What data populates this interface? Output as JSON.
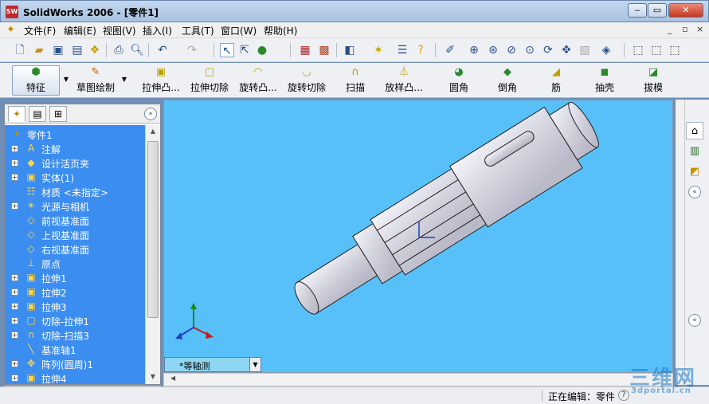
{
  "window": {
    "title": "SolidWorks 2006 - [零件1]",
    "app_icon": "SW"
  },
  "menu": [
    "文件(F)",
    "编辑(E)",
    "视图(V)",
    "插入(I)",
    "工具(T)",
    "窗口(W)",
    "帮助(H)"
  ],
  "mdi_controls": [
    "_",
    "▫",
    "×"
  ],
  "toolbar_icons": [
    "new-icon",
    "open-icon",
    "save-icon",
    "print-icon",
    "undo-icon",
    "redo-icon",
    "select-icon",
    "zoom-icon",
    "rotate-icon",
    "pan-icon",
    "view-orientation-icon"
  ],
  "features_toolbar": {
    "features_tab": "特征",
    "sketch_tab": "草图绘制",
    "buttons": [
      "拉伸凸...",
      "拉伸切除",
      "旋转凸...",
      "旋转切除",
      "扫描",
      "放样凸...",
      "圆角",
      "倒角",
      "筋",
      "抽壳",
      "拔模"
    ]
  },
  "feature_tree": {
    "root": "零件1",
    "items": [
      {
        "label": "注解",
        "icon": "annotation-icon",
        "expandable": true
      },
      {
        "label": "设计活页夹",
        "icon": "design-binder-icon",
        "expandable": true
      },
      {
        "label": "实体(1)",
        "icon": "solid-body-icon",
        "expandable": true
      },
      {
        "label": "材质 <未指定>",
        "icon": "material-icon",
        "expandable": false
      },
      {
        "label": "光源与相机",
        "icon": "lights-cameras-icon",
        "expandable": true
      },
      {
        "label": "前视基准面",
        "icon": "plane-icon",
        "expandable": false
      },
      {
        "label": "上视基准面",
        "icon": "plane-icon",
        "expandable": false
      },
      {
        "label": "右视基准面",
        "icon": "plane-icon",
        "expandable": false
      },
      {
        "label": "原点",
        "icon": "origin-icon",
        "expandable": false
      },
      {
        "label": "拉伸1",
        "icon": "extrude-icon",
        "expandable": true
      },
      {
        "label": "拉伸2",
        "icon": "extrude-icon",
        "expandable": true
      },
      {
        "label": "拉伸3",
        "icon": "extrude-icon",
        "expandable": true
      },
      {
        "label": "切除-拉伸1",
        "icon": "cut-extrude-icon",
        "expandable": true
      },
      {
        "label": "切除-扫描3",
        "icon": "cut-sweep-icon",
        "expandable": true
      },
      {
        "label": "基准轴1",
        "icon": "axis-icon",
        "expandable": false
      },
      {
        "label": "阵列(圆周)1",
        "icon": "circular-pattern-icon",
        "expandable": true
      },
      {
        "label": "拉伸4",
        "icon": "extrude-icon",
        "expandable": true
      }
    ]
  },
  "viewport": {
    "view_name": "*等轴测",
    "background": "#58c0f9"
  },
  "status": {
    "text": "正在编辑：零件",
    "help": "?"
  },
  "watermark": {
    "big": "三维网",
    "small": "3dportal.cn"
  },
  "colors": {
    "tree_selection": "#3b8df0",
    "viewport_bg": "#58c0f9",
    "part_color": "#d9d9e4"
  }
}
